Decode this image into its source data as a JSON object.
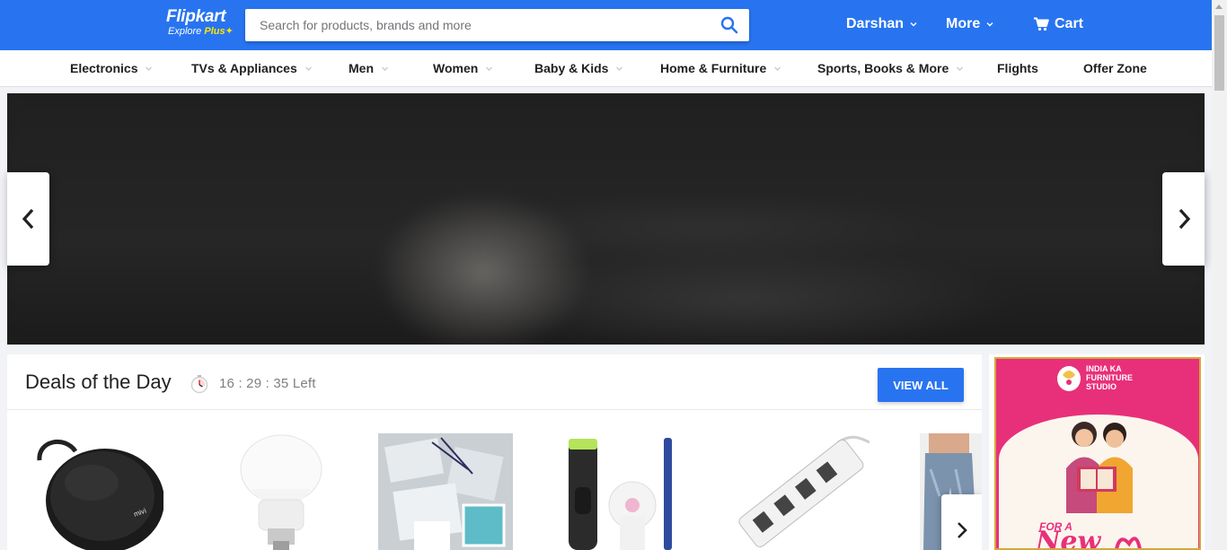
{
  "header": {
    "logo_name": "Flipkart",
    "logo_tagline": "Explore",
    "logo_plus": "Plus",
    "search_placeholder": "Search for products, brands and more",
    "user_label": "Darshan",
    "more_label": "More",
    "cart_label": "Cart",
    "brand_color": "#2874f0"
  },
  "nav": {
    "items": [
      {
        "label": "Electronics",
        "has_dropdown": true
      },
      {
        "label": "TVs & Appliances",
        "has_dropdown": true
      },
      {
        "label": "Men",
        "has_dropdown": true
      },
      {
        "label": "Women",
        "has_dropdown": true
      },
      {
        "label": "Baby & Kids",
        "has_dropdown": true
      },
      {
        "label": "Home & Furniture",
        "has_dropdown": true
      },
      {
        "label": "Sports, Books & More",
        "has_dropdown": true
      },
      {
        "label": "Flights",
        "has_dropdown": false
      },
      {
        "label": "Offer Zone",
        "has_dropdown": false
      }
    ]
  },
  "banner": {
    "icons": [
      "chevron-left-icon",
      "chevron-right-icon"
    ]
  },
  "deals": {
    "title": "Deals of the Day",
    "timer": "16 : 29 : 35 Left",
    "view_all_label": "VIEW ALL",
    "products": [
      "bluetooth-speaker",
      "led-bulb",
      "wall-switches",
      "trimmer-epilator-toothbrush",
      "extension-board",
      "jeans"
    ]
  },
  "ad": {
    "brand_line1": "INDIA KA",
    "brand_line2": "FURNITURE",
    "brand_line3": "STUDIO",
    "for_text": "FOR A",
    "new_text": "New"
  }
}
